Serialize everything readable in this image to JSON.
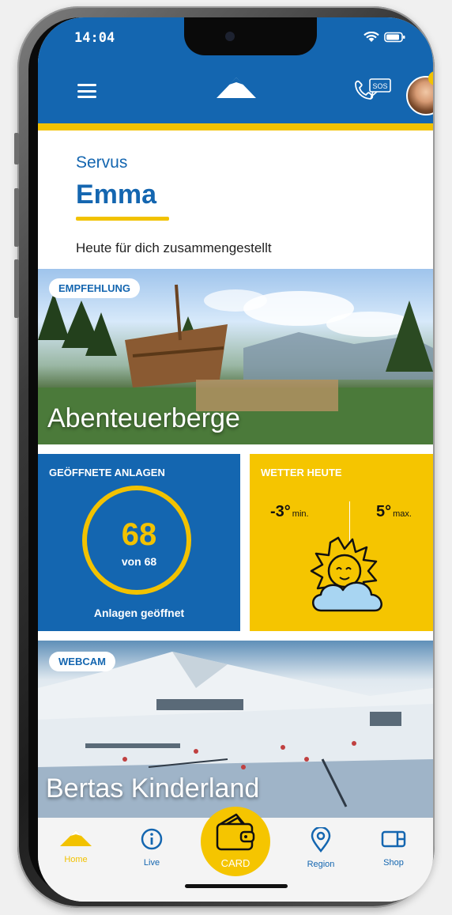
{
  "status_bar": {
    "time": "14:04"
  },
  "header": {
    "menu_icon": "hamburger-icon",
    "logo_icon": "mountain-logo-icon",
    "sos_label": "SOS",
    "avatar_icon": "user-avatar",
    "accent": "#f2c200",
    "brand": "#1466b0"
  },
  "greeting": {
    "hello": "Servus",
    "name": "Emma",
    "subtitle": "Heute für dich zusammengestellt"
  },
  "recommendation": {
    "tag": "EMPFEHLUNG",
    "title": "Abenteuerberge"
  },
  "lifts": {
    "label": "GEÖFFNETE ANLAGEN",
    "open_count": "68",
    "of_total": "von 68",
    "caption": "Anlagen geöffnet"
  },
  "weather": {
    "label": "WETTER HEUTE",
    "min_value": "-3°",
    "min_label": "min.",
    "max_value": "5°",
    "max_label": "max.",
    "icon": "sun-cloud-icon"
  },
  "webcam": {
    "tag": "WEBCAM",
    "title": "Bertas Kinderland"
  },
  "nav": {
    "home": "Home",
    "live": "Live",
    "card": "CARD",
    "region": "Region",
    "shop": "Shop"
  }
}
